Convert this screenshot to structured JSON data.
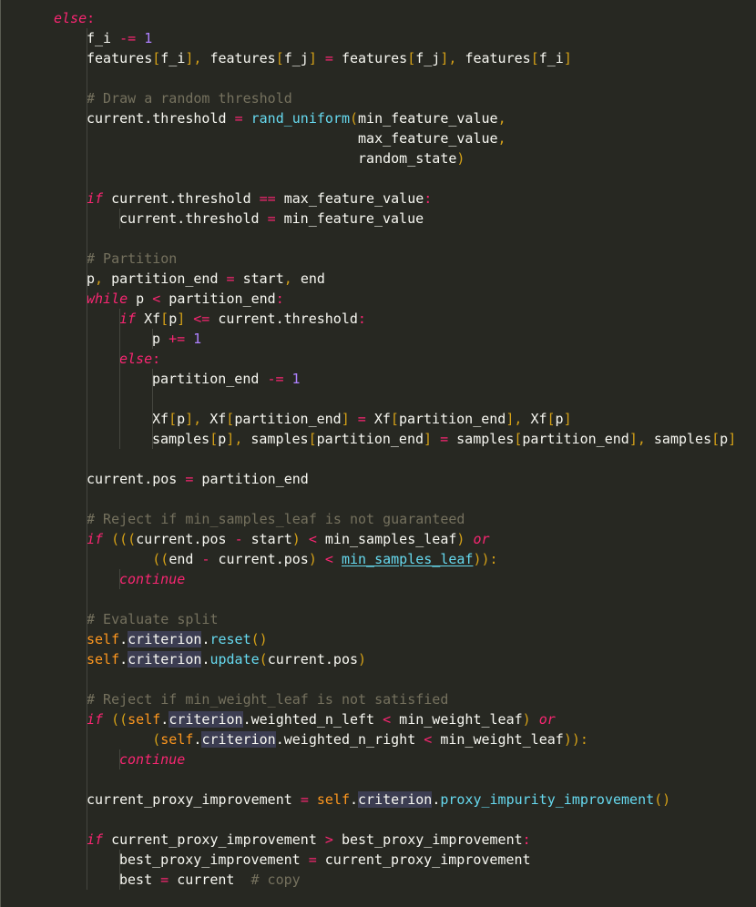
{
  "editor": {
    "language": "python",
    "theme_colors": {
      "background": "#272822",
      "keyword": "#f92672",
      "number": "#ae81ff",
      "bracket": "#d4a017",
      "function": "#66d9ef",
      "self": "#fd971f",
      "comment": "#75715e",
      "text": "#f8f8f2",
      "highlight": "#3c3d52"
    },
    "lines": [
      {
        "indent": 0,
        "tokens": [
          {
            "t": "else",
            "c": "k-it"
          },
          {
            "t": ":",
            "c": "op"
          }
        ]
      },
      {
        "indent": 1,
        "tokens": [
          {
            "t": "f_i ",
            "c": "var"
          },
          {
            "t": "-=",
            "c": "op"
          },
          {
            "t": " ",
            "c": "var"
          },
          {
            "t": "1",
            "c": "num"
          }
        ]
      },
      {
        "indent": 1,
        "tokens": [
          {
            "t": "features",
            "c": "var"
          },
          {
            "t": "[",
            "c": "punc"
          },
          {
            "t": "f_i",
            "c": "var"
          },
          {
            "t": "]",
            "c": "punc"
          },
          {
            "t": ", ",
            "c": "punc"
          },
          {
            "t": "features",
            "c": "var"
          },
          {
            "t": "[",
            "c": "punc"
          },
          {
            "t": "f_j",
            "c": "var"
          },
          {
            "t": "]",
            "c": "punc"
          },
          {
            "t": " ",
            "c": "var"
          },
          {
            "t": "=",
            "c": "op"
          },
          {
            "t": " features",
            "c": "var"
          },
          {
            "t": "[",
            "c": "punc"
          },
          {
            "t": "f_j",
            "c": "var"
          },
          {
            "t": "]",
            "c": "punc"
          },
          {
            "t": ", ",
            "c": "punc"
          },
          {
            "t": "features",
            "c": "var"
          },
          {
            "t": "[",
            "c": "punc"
          },
          {
            "t": "f_i",
            "c": "var"
          },
          {
            "t": "]",
            "c": "punc"
          }
        ]
      },
      {
        "indent": 1,
        "tokens": []
      },
      {
        "indent": 1,
        "tokens": [
          {
            "t": "# Draw a random threshold",
            "c": "cm"
          }
        ]
      },
      {
        "indent": 1,
        "tokens": [
          {
            "t": "current.threshold ",
            "c": "var"
          },
          {
            "t": "=",
            "c": "op"
          },
          {
            "t": " ",
            "c": "var"
          },
          {
            "t": "rand_uniform",
            "c": "fn"
          },
          {
            "t": "(",
            "c": "punc"
          },
          {
            "t": "min_feature_value",
            "c": "var"
          },
          {
            "t": ",",
            "c": "punc"
          }
        ]
      },
      {
        "indent": 1,
        "tokens": [
          {
            "t": "                                 max_feature_value",
            "c": "var"
          },
          {
            "t": ",",
            "c": "punc"
          }
        ]
      },
      {
        "indent": 1,
        "tokens": [
          {
            "t": "                                 random_state",
            "c": "var"
          },
          {
            "t": ")",
            "c": "punc"
          }
        ]
      },
      {
        "indent": 1,
        "tokens": []
      },
      {
        "indent": 1,
        "tokens": [
          {
            "t": "if",
            "c": "k-it"
          },
          {
            "t": " current.threshold ",
            "c": "var"
          },
          {
            "t": "==",
            "c": "op"
          },
          {
            "t": " max_feature_value",
            "c": "var"
          },
          {
            "t": ":",
            "c": "op"
          }
        ]
      },
      {
        "indent": 2,
        "tokens": [
          {
            "t": "current.threshold ",
            "c": "var"
          },
          {
            "t": "=",
            "c": "op"
          },
          {
            "t": " min_feature_value",
            "c": "var"
          }
        ]
      },
      {
        "indent": 1,
        "tokens": []
      },
      {
        "indent": 1,
        "tokens": [
          {
            "t": "# Partition",
            "c": "cm"
          }
        ]
      },
      {
        "indent": 1,
        "tokens": [
          {
            "t": "p",
            "c": "var"
          },
          {
            "t": ", ",
            "c": "punc"
          },
          {
            "t": "partition_end ",
            "c": "var"
          },
          {
            "t": "=",
            "c": "op"
          },
          {
            "t": " start",
            "c": "var"
          },
          {
            "t": ", ",
            "c": "punc"
          },
          {
            "t": "end",
            "c": "var"
          }
        ]
      },
      {
        "indent": 1,
        "tokens": [
          {
            "t": "while",
            "c": "k-it"
          },
          {
            "t": " p ",
            "c": "var"
          },
          {
            "t": "<",
            "c": "op"
          },
          {
            "t": " partition_end",
            "c": "var"
          },
          {
            "t": ":",
            "c": "op"
          }
        ]
      },
      {
        "indent": 2,
        "tokens": [
          {
            "t": "if",
            "c": "k-it"
          },
          {
            "t": " Xf",
            "c": "var"
          },
          {
            "t": "[",
            "c": "punc"
          },
          {
            "t": "p",
            "c": "var"
          },
          {
            "t": "]",
            "c": "punc"
          },
          {
            "t": " ",
            "c": "var"
          },
          {
            "t": "<=",
            "c": "op"
          },
          {
            "t": " current.threshold",
            "c": "var"
          },
          {
            "t": ":",
            "c": "op"
          }
        ]
      },
      {
        "indent": 3,
        "tokens": [
          {
            "t": "p ",
            "c": "var"
          },
          {
            "t": "+=",
            "c": "op"
          },
          {
            "t": " ",
            "c": "var"
          },
          {
            "t": "1",
            "c": "num"
          }
        ]
      },
      {
        "indent": 2,
        "tokens": [
          {
            "t": "else",
            "c": "k-it"
          },
          {
            "t": ":",
            "c": "op"
          }
        ]
      },
      {
        "indent": 3,
        "tokens": [
          {
            "t": "partition_end ",
            "c": "var"
          },
          {
            "t": "-=",
            "c": "op"
          },
          {
            "t": " ",
            "c": "var"
          },
          {
            "t": "1",
            "c": "num"
          }
        ]
      },
      {
        "indent": 3,
        "tokens": []
      },
      {
        "indent": 3,
        "tokens": [
          {
            "t": "Xf",
            "c": "var"
          },
          {
            "t": "[",
            "c": "punc"
          },
          {
            "t": "p",
            "c": "var"
          },
          {
            "t": "]",
            "c": "punc"
          },
          {
            "t": ", ",
            "c": "punc"
          },
          {
            "t": "Xf",
            "c": "var"
          },
          {
            "t": "[",
            "c": "punc"
          },
          {
            "t": "partition_end",
            "c": "var"
          },
          {
            "t": "]",
            "c": "punc"
          },
          {
            "t": " ",
            "c": "var"
          },
          {
            "t": "=",
            "c": "op"
          },
          {
            "t": " Xf",
            "c": "var"
          },
          {
            "t": "[",
            "c": "punc"
          },
          {
            "t": "partition_end",
            "c": "var"
          },
          {
            "t": "]",
            "c": "punc"
          },
          {
            "t": ", ",
            "c": "punc"
          },
          {
            "t": "Xf",
            "c": "var"
          },
          {
            "t": "[",
            "c": "punc"
          },
          {
            "t": "p",
            "c": "var"
          },
          {
            "t": "]",
            "c": "punc"
          }
        ]
      },
      {
        "indent": 3,
        "tokens": [
          {
            "t": "samples",
            "c": "var"
          },
          {
            "t": "[",
            "c": "punc"
          },
          {
            "t": "p",
            "c": "var"
          },
          {
            "t": "]",
            "c": "punc"
          },
          {
            "t": ", ",
            "c": "punc"
          },
          {
            "t": "samples",
            "c": "var"
          },
          {
            "t": "[",
            "c": "punc"
          },
          {
            "t": "partition_end",
            "c": "var"
          },
          {
            "t": "]",
            "c": "punc"
          },
          {
            "t": " ",
            "c": "var"
          },
          {
            "t": "=",
            "c": "op"
          },
          {
            "t": " samples",
            "c": "var"
          },
          {
            "t": "[",
            "c": "punc"
          },
          {
            "t": "partition_end",
            "c": "var"
          },
          {
            "t": "]",
            "c": "punc"
          },
          {
            "t": ", ",
            "c": "punc"
          },
          {
            "t": "samples",
            "c": "var"
          },
          {
            "t": "[",
            "c": "punc"
          },
          {
            "t": "p",
            "c": "var"
          },
          {
            "t": "]",
            "c": "punc"
          }
        ]
      },
      {
        "indent": 1,
        "tokens": []
      },
      {
        "indent": 1,
        "tokens": [
          {
            "t": "current.pos ",
            "c": "var"
          },
          {
            "t": "=",
            "c": "op"
          },
          {
            "t": " partition_end",
            "c": "var"
          }
        ]
      },
      {
        "indent": 1,
        "tokens": []
      },
      {
        "indent": 1,
        "tokens": [
          {
            "t": "# Reject if min_samples_leaf is not guaranteed",
            "c": "cm"
          }
        ]
      },
      {
        "indent": 1,
        "tokens": [
          {
            "t": "if",
            "c": "k-it"
          },
          {
            "t": " ",
            "c": "var"
          },
          {
            "t": "(((",
            "c": "punc"
          },
          {
            "t": "current.pos ",
            "c": "var"
          },
          {
            "t": "-",
            "c": "op"
          },
          {
            "t": " start",
            "c": "var"
          },
          {
            "t": ")",
            "c": "punc"
          },
          {
            "t": " ",
            "c": "var"
          },
          {
            "t": "<",
            "c": "op"
          },
          {
            "t": " min_samples_leaf",
            "c": "var"
          },
          {
            "t": ")",
            "c": "punc"
          },
          {
            "t": " ",
            "c": "var"
          },
          {
            "t": "or",
            "c": "k-it"
          }
        ]
      },
      {
        "indent": 1,
        "tokens": [
          {
            "t": "        ",
            "c": "var"
          },
          {
            "t": "((",
            "c": "punc"
          },
          {
            "t": "end ",
            "c": "var"
          },
          {
            "t": "-",
            "c": "op"
          },
          {
            "t": " current.pos",
            "c": "var"
          },
          {
            "t": ")",
            "c": "punc"
          },
          {
            "t": " ",
            "c": "var"
          },
          {
            "t": "<",
            "c": "op"
          },
          {
            "t": " ",
            "c": "var"
          },
          {
            "t": "min_samples_leaf",
            "c": "link"
          },
          {
            "t": ")):",
            "c": "punc"
          }
        ]
      },
      {
        "indent": 2,
        "tokens": [
          {
            "t": "continue",
            "c": "k-it"
          }
        ]
      },
      {
        "indent": 1,
        "tokens": []
      },
      {
        "indent": 1,
        "tokens": [
          {
            "t": "# Evaluate split",
            "c": "cm"
          }
        ]
      },
      {
        "indent": 1,
        "tokens": [
          {
            "t": "self",
            "c": "self"
          },
          {
            "t": ".",
            "c": "var"
          },
          {
            "t": "criterion",
            "c": "hl"
          },
          {
            "t": ".",
            "c": "var"
          },
          {
            "t": "reset",
            "c": "fn"
          },
          {
            "t": "()",
            "c": "punc"
          }
        ]
      },
      {
        "indent": 1,
        "tokens": [
          {
            "t": "self",
            "c": "self"
          },
          {
            "t": ".",
            "c": "var"
          },
          {
            "t": "criterion",
            "c": "hl"
          },
          {
            "t": ".",
            "c": "var"
          },
          {
            "t": "update",
            "c": "fn"
          },
          {
            "t": "(",
            "c": "punc"
          },
          {
            "t": "current.pos",
            "c": "var"
          },
          {
            "t": ")",
            "c": "punc"
          }
        ]
      },
      {
        "indent": 1,
        "tokens": []
      },
      {
        "indent": 1,
        "tokens": [
          {
            "t": "# Reject if min_weight_leaf is not satisfied",
            "c": "cm"
          }
        ]
      },
      {
        "indent": 1,
        "tokens": [
          {
            "t": "if",
            "c": "k-it"
          },
          {
            "t": " ",
            "c": "var"
          },
          {
            "t": "((",
            "c": "punc"
          },
          {
            "t": "self",
            "c": "self"
          },
          {
            "t": ".",
            "c": "var"
          },
          {
            "t": "criterion",
            "c": "hl"
          },
          {
            "t": ".weighted_n_left ",
            "c": "var"
          },
          {
            "t": "<",
            "c": "op"
          },
          {
            "t": " min_weight_leaf",
            "c": "var"
          },
          {
            "t": ")",
            "c": "punc"
          },
          {
            "t": " ",
            "c": "var"
          },
          {
            "t": "or",
            "c": "k-it"
          }
        ]
      },
      {
        "indent": 1,
        "tokens": [
          {
            "t": "        ",
            "c": "var"
          },
          {
            "t": "(",
            "c": "punc"
          },
          {
            "t": "self",
            "c": "self"
          },
          {
            "t": ".",
            "c": "var"
          },
          {
            "t": "criterion",
            "c": "hl"
          },
          {
            "t": ".weighted_n_right ",
            "c": "var"
          },
          {
            "t": "<",
            "c": "op"
          },
          {
            "t": " min_weight_leaf",
            "c": "var"
          },
          {
            "t": ")):",
            "c": "punc"
          }
        ]
      },
      {
        "indent": 2,
        "tokens": [
          {
            "t": "continue",
            "c": "k-it"
          }
        ]
      },
      {
        "indent": 1,
        "tokens": []
      },
      {
        "indent": 1,
        "tokens": [
          {
            "t": "current_proxy_improvement ",
            "c": "var"
          },
          {
            "t": "=",
            "c": "op"
          },
          {
            "t": " ",
            "c": "var"
          },
          {
            "t": "self",
            "c": "self"
          },
          {
            "t": ".",
            "c": "var"
          },
          {
            "t": "criterion",
            "c": "hl"
          },
          {
            "t": ".",
            "c": "var"
          },
          {
            "t": "proxy_impurity_improvement",
            "c": "fn"
          },
          {
            "t": "()",
            "c": "punc"
          }
        ]
      },
      {
        "indent": 1,
        "tokens": []
      },
      {
        "indent": 1,
        "tokens": [
          {
            "t": "if",
            "c": "k-it"
          },
          {
            "t": " current_proxy_improvement ",
            "c": "var"
          },
          {
            "t": ">",
            "c": "op"
          },
          {
            "t": " best_proxy_improvement",
            "c": "var"
          },
          {
            "t": ":",
            "c": "op"
          }
        ]
      },
      {
        "indent": 2,
        "tokens": [
          {
            "t": "best_proxy_improvement ",
            "c": "var"
          },
          {
            "t": "=",
            "c": "op"
          },
          {
            "t": " current_proxy_improvement",
            "c": "var"
          }
        ]
      },
      {
        "indent": 2,
        "tokens": [
          {
            "t": "best ",
            "c": "var"
          },
          {
            "t": "=",
            "c": "op"
          },
          {
            "t": " current  ",
            "c": "var"
          },
          {
            "t": "# copy",
            "c": "cm"
          }
        ]
      }
    ]
  }
}
